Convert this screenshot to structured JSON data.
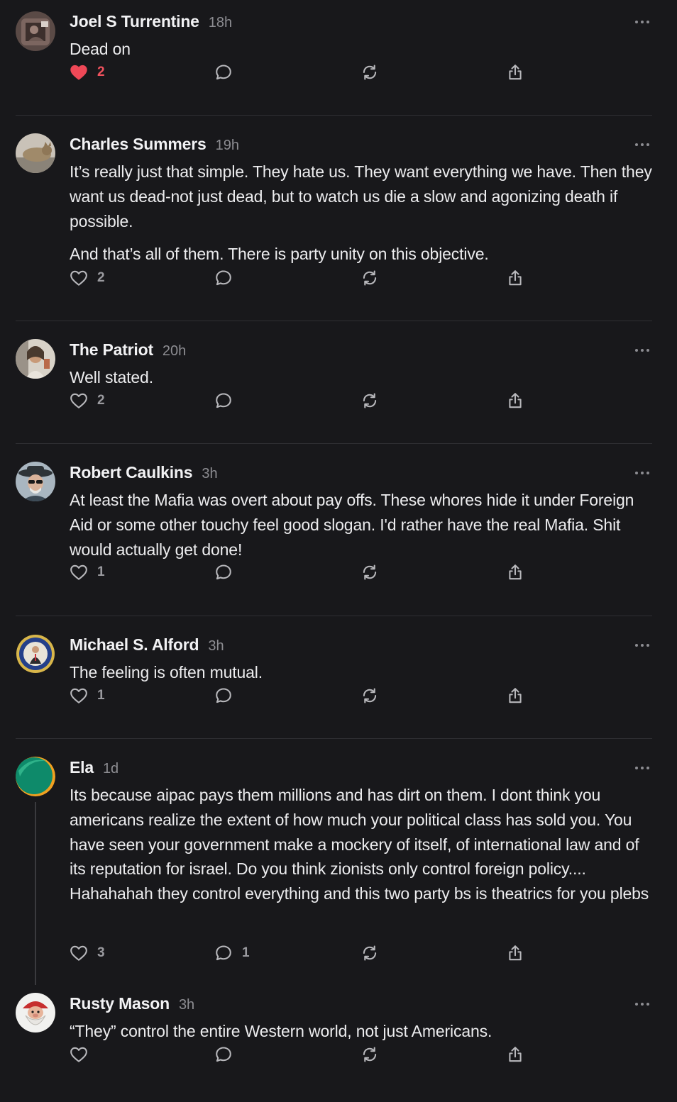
{
  "colors": {
    "background": "#18181b",
    "text": "#ececee",
    "muted": "#8d8d92",
    "like_active": "#ef4857",
    "icon": "#b8b8bc",
    "divider": "#2f2f33"
  },
  "comments": [
    {
      "author": "Joel S Turrentine",
      "time": "18h",
      "paragraphs": [
        "Dead on"
      ],
      "likes": "2",
      "liked": true,
      "replies": "",
      "avatar_icon": "user-photo-avatar"
    },
    {
      "author": "Charles Summers",
      "time": "19h",
      "paragraphs": [
        "It’s really just that simple. They hate us. They want everything we have. Then they want us dead-not just dead, but to watch us die a slow and agonizing death if possible.",
        "And that’s all of them. There is party unity on this objective."
      ],
      "likes": "2",
      "liked": false,
      "replies": "",
      "avatar_icon": "cat-photo-avatar"
    },
    {
      "author": "The Patriot",
      "time": "20h",
      "paragraphs": [
        "Well stated."
      ],
      "likes": "2",
      "liked": false,
      "replies": "",
      "avatar_icon": "user-photo-avatar"
    },
    {
      "author": "Robert Caulkins",
      "time": "3h",
      "paragraphs": [
        "At least the Mafia was overt about pay offs. These whores hide it under Foreign Aid or some other touchy feel good slogan. I'd rather have the real Mafia. Shit would actually get done!"
      ],
      "likes": "1",
      "liked": false,
      "replies": "",
      "avatar_icon": "user-photo-avatar"
    },
    {
      "author": "Michael S. Alford",
      "time": "3h",
      "paragraphs": [
        "The feeling is often mutual."
      ],
      "likes": "1",
      "liked": false,
      "replies": "",
      "avatar_icon": "seal-avatar"
    },
    {
      "author": "Ela",
      "time": "1d",
      "paragraphs": [
        "Its because aipac pays them millions and has dirt on them. I dont think you americans realize the extent of how much your political class has sold you. You have seen your government make a mockery of itself, of international law and of its reputation for israel. Do you think zionists only control foreign policy.... Hahahahah they control everything and this two party bs is theatrics for you plebs"
      ],
      "likes": "3",
      "liked": false,
      "replies": "1",
      "avatar_icon": "gradient-circle-avatar"
    },
    {
      "author": "Rusty Mason",
      "time": "3h",
      "paragraphs": [
        "“They” control the entire Western world, not just Americans."
      ],
      "likes": "",
      "liked": false,
      "replies": "",
      "avatar_icon": "gnome-avatar"
    }
  ],
  "icons": {
    "like": "heart-icon",
    "reply": "comment-bubble-icon",
    "restack": "restack-icon",
    "share": "share-icon",
    "more": "more-options-icon"
  }
}
